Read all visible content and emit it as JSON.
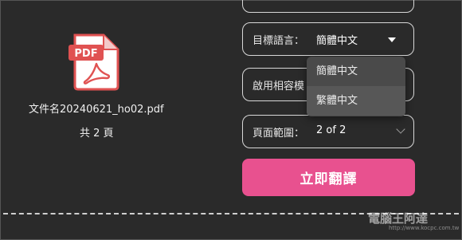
{
  "file": {
    "name": "文件名20240621_ho02.pdf",
    "pages": "共 2 頁",
    "icon_text": "PDF",
    "icon": "pdf-file-icon"
  },
  "target_language": {
    "label": "目標語言：",
    "value": "簡體中文",
    "options": [
      "簡體中文",
      "繁體中文"
    ]
  },
  "compat_mode": {
    "label": "啟用相容模"
  },
  "page_range": {
    "label": "頁面範圍：",
    "value": "2 of 2"
  },
  "translate_button": {
    "label": "立即翻譯"
  },
  "watermark": {
    "text": "電腦王阿達",
    "url": "http://www.kocpc.com.tw"
  },
  "colors": {
    "background": "#2a2a2a",
    "accent": "#e8518f",
    "pdf_red": "#e05252"
  }
}
